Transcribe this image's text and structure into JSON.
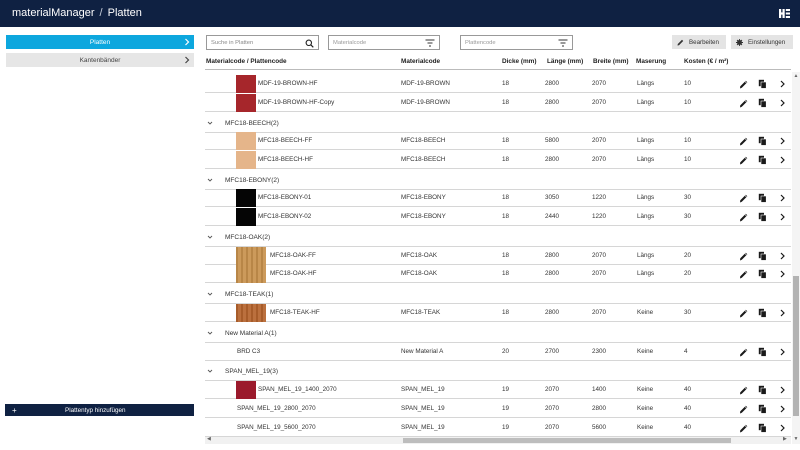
{
  "app": {
    "title": "materialManager",
    "separator": "/",
    "section": "Platten"
  },
  "sidebar": {
    "items": [
      {
        "label": "Platten",
        "active": true
      },
      {
        "label": "Kantenbänder",
        "active": false
      }
    ],
    "add_button": {
      "icon": "+",
      "label": "Plattentyp hinzufügen"
    }
  },
  "toolbar": {
    "search_placeholder": "Suche in Platten",
    "material_filter_placeholder": "Materialcode",
    "panel_filter_placeholder": "Plattencode",
    "edit_label": "Bearbeiten",
    "settings_label": "Einstellungen"
  },
  "table": {
    "headers": [
      "Materialcode / Plattencode",
      "Materialcode",
      "Dicke (mm)",
      "Länge (mm)",
      "Breite (mm)",
      "Maserung",
      "Kosten (€ / m²)"
    ],
    "rows": [
      {
        "type": "data",
        "code": "MDF-19-BROWN-HF",
        "material": "MDF-19-BROWN",
        "thickness": "18",
        "length": "2800",
        "width": "2070",
        "grain": "Längs",
        "cost": "10",
        "swatch": "#a6262b"
      },
      {
        "type": "data",
        "code": "MDF-19-BROWN-HF-Copy",
        "material": "MDF-19-BROWN",
        "thickness": "18",
        "length": "2800",
        "width": "2070",
        "grain": "Längs",
        "cost": "10",
        "swatch": "#a6262b"
      },
      {
        "type": "group",
        "label": "MFC18-BEECH(2)"
      },
      {
        "type": "data",
        "code": "MFC18-BEECH-FF",
        "material": "MFC18-BEECH",
        "thickness": "18",
        "length": "5800",
        "width": "2070",
        "grain": "Längs",
        "cost": "10",
        "swatch": "#e5b58a"
      },
      {
        "type": "data",
        "code": "MFC18-BEECH-HF",
        "material": "MFC18-BEECH",
        "thickness": "18",
        "length": "2800",
        "width": "2070",
        "grain": "Längs",
        "cost": "10",
        "swatch": "#e5b58a"
      },
      {
        "type": "group",
        "label": "MFC18-EBONY(2)"
      },
      {
        "type": "data",
        "code": "MFC18-EBONY-01",
        "material": "MFC18-EBONY",
        "thickness": "18",
        "length": "3050",
        "width": "1220",
        "grain": "Längs",
        "cost": "30",
        "swatch": "#050505"
      },
      {
        "type": "data",
        "code": "MFC18-EBONY-02",
        "material": "MFC18-EBONY",
        "thickness": "18",
        "length": "2440",
        "width": "1220",
        "grain": "Längs",
        "cost": "30",
        "swatch": "#050505"
      },
      {
        "type": "group",
        "label": "MFC18-OAK(2)"
      },
      {
        "type": "data",
        "code": "MFC18-OAK-FF",
        "material": "MFC18-OAK",
        "thickness": "18",
        "length": "2800",
        "width": "2070",
        "grain": "Längs",
        "cost": "20",
        "swatch": "#c8914d",
        "wide": true
      },
      {
        "type": "data",
        "code": "MFC18-OAK-HF",
        "material": "MFC18-OAK",
        "thickness": "18",
        "length": "2800",
        "width": "2070",
        "grain": "Längs",
        "cost": "20",
        "swatch": "#c8914d",
        "wide": true
      },
      {
        "type": "group",
        "label": "MFC18-TEAK(1)"
      },
      {
        "type": "data",
        "code": "MFC18-TEAK-HF",
        "material": "MFC18-TEAK",
        "thickness": "18",
        "length": "2800",
        "width": "2070",
        "grain": "Keine",
        "cost": "30",
        "swatch": "#b5642e",
        "wide": true
      },
      {
        "type": "group",
        "label": "New Material A(1)"
      },
      {
        "type": "data",
        "code": "BRD C3",
        "material": "New Material A",
        "thickness": "20",
        "length": "2700",
        "width": "2300",
        "grain": "Keine",
        "cost": "4",
        "swatch": null,
        "flat": true
      },
      {
        "type": "group",
        "label": "SPAN_MEL_19(3)"
      },
      {
        "type": "data",
        "code": "SPAN_MEL_19_1400_2070",
        "material": "SPAN_MEL_19",
        "thickness": "19",
        "length": "2070",
        "width": "1400",
        "grain": "Keine",
        "cost": "40",
        "swatch": "#9b1a2c"
      },
      {
        "type": "data",
        "code": "SPAN_MEL_19_2800_2070",
        "material": "SPAN_MEL_19",
        "thickness": "19",
        "length": "2070",
        "width": "2800",
        "grain": "Keine",
        "cost": "40",
        "swatch": null,
        "flat": true
      },
      {
        "type": "data",
        "code": "SPAN_MEL_19_5600_2070",
        "material": "SPAN_MEL_19",
        "thickness": "19",
        "length": "2070",
        "width": "5600",
        "grain": "Keine",
        "cost": "40",
        "swatch": null,
        "flat": true
      }
    ]
  },
  "colors": {
    "navy": "#0f2142",
    "accent": "#0da7de"
  }
}
